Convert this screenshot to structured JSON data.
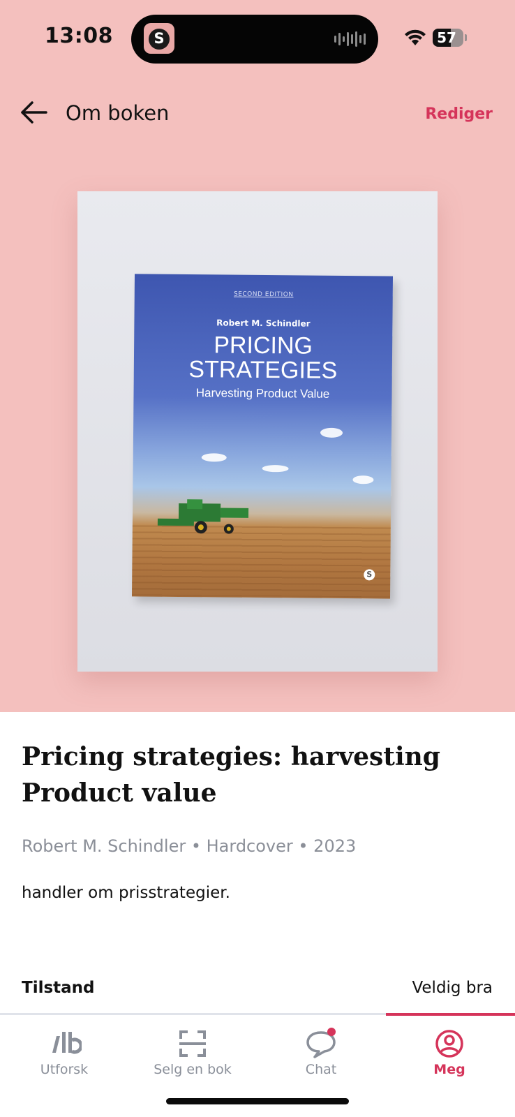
{
  "status_bar": {
    "time": "13:08",
    "battery": "57",
    "island_app_letter": "S"
  },
  "header": {
    "title": "Om boken",
    "edit_label": "Rediger",
    "back_icon": "arrow-left-icon"
  },
  "cover_image": {
    "edition": "SECOND EDITION",
    "author": "Robert M. Schindler",
    "title_line1": "PRICING",
    "title_line2": "STRATEGIES",
    "subtitle": "Harvesting Product Value",
    "publisher_logo": "S"
  },
  "book": {
    "title": "Pricing strategies: harvesting Product value",
    "meta": "Robert M. Schindler  • Hardcover • 2023",
    "description": "handler om prisstrategier."
  },
  "condition": {
    "label": "Tilstand",
    "value": "Veldig bra"
  },
  "nav": {
    "items": [
      {
        "label": "Utforsk",
        "icon": "explore-logo-icon"
      },
      {
        "label": "Selg en bok",
        "icon": "scan-icon"
      },
      {
        "label": "Chat",
        "icon": "chat-bubble-icon"
      },
      {
        "label": "Meg",
        "icon": "profile-icon"
      }
    ],
    "active_index": 3
  },
  "colors": {
    "accent": "#d5345a",
    "top_background": "#f4c0be",
    "muted_text": "#8b8f98"
  }
}
